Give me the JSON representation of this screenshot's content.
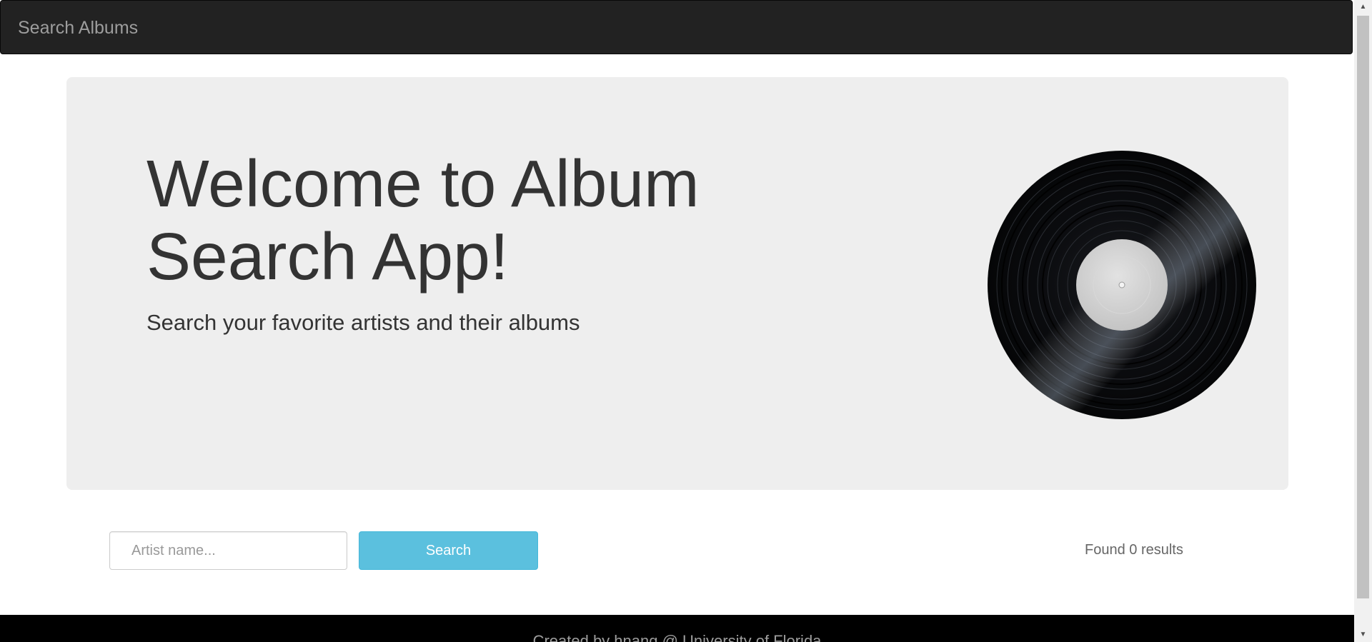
{
  "navbar": {
    "brand": "Search Albums"
  },
  "jumbotron": {
    "title": "Welcome to Album Search App!",
    "subtitle": "Search your favorite artists and their albums",
    "image_icon": "vinyl-record"
  },
  "search": {
    "placeholder": "Artist name...",
    "value": "",
    "button_label": "Search",
    "results_text": "Found 0 results"
  },
  "footer": {
    "text": "Created by hnang @ University of Florida"
  },
  "colors": {
    "navbar_bg": "#222222",
    "jumbotron_bg": "#eeeeee",
    "search_button": "#5bc0de",
    "footer_bg": "#000000"
  }
}
